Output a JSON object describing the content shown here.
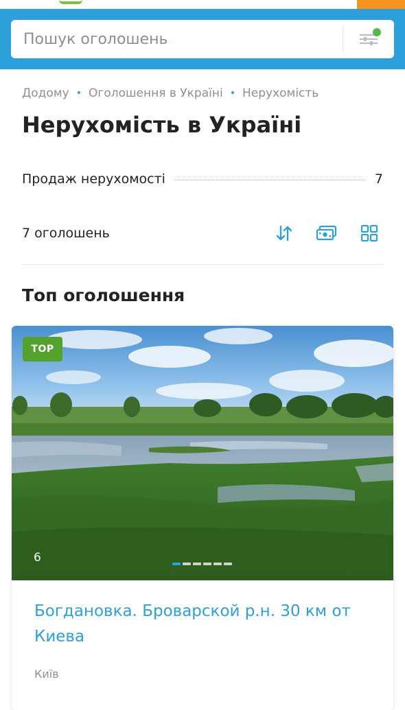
{
  "header": {
    "search_placeholder": "Пошук оголошень",
    "accent_color": "#2d9fdb",
    "filter_indicator_color": "#54b948"
  },
  "breadcrumb": [
    {
      "label": "Додому"
    },
    {
      "label": "Оголошення в Україні"
    },
    {
      "label": "Нерухомість"
    }
  ],
  "page_title": "Нерухомість в Україні",
  "categories": [
    {
      "label": "Продаж нерухомості",
      "count": "7"
    }
  ],
  "listing_count": "7 оголошень",
  "toolbar_icons": [
    "sort-icon",
    "price-view-icon",
    "grid-view-icon"
  ],
  "section_title": "Топ оголошення",
  "featured": {
    "badge": "TOP",
    "photo_count": "6",
    "photo_dots": 6,
    "photo_dot_active": 0,
    "title": "Богдановка. Броварской р.н. 30 км от Киева",
    "city": "Київ"
  }
}
